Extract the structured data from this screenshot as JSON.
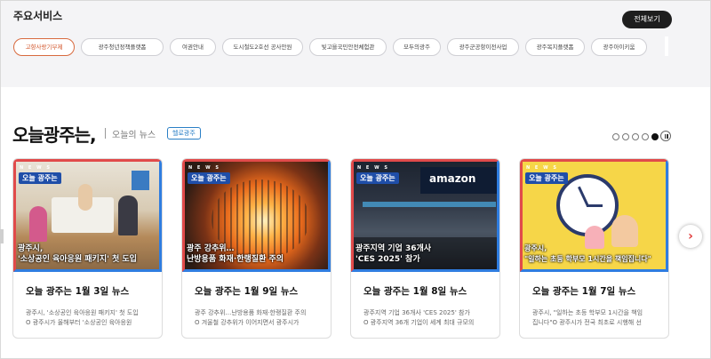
{
  "services": {
    "title": "주요서비스",
    "view_all": "전체보기",
    "chips": [
      {
        "label": "고향사랑기부제",
        "active": true
      },
      {
        "label": "광주청년정책플랫폼",
        "active": false
      },
      {
        "label": "여권안내",
        "active": false
      },
      {
        "label": "도시철도2호선 공사안원",
        "active": false
      },
      {
        "label": "빛고을국민안전체험관",
        "active": false
      },
      {
        "label": "모두의광주",
        "active": false
      },
      {
        "label": "광주군공항이전사업",
        "active": false
      },
      {
        "label": "광주복지플랫폼",
        "active": false
      },
      {
        "label": "광주아이키움",
        "active": false
      }
    ]
  },
  "news": {
    "title": "오늘광주는,",
    "subtitle": "오늘의 뉴스",
    "badge": "헬로광주",
    "pager_count": 5,
    "pager_active": 4,
    "cards": [
      {
        "title": "오늘 광주는 1월 3일 뉴스",
        "tag": "N E W S",
        "label": "오늘 광주는",
        "caption": "광주시,\n'소상공인 육아응원 패키지' 첫 도입",
        "body": "광주시, '소상공인 육아응원 패키지' 첫 도입\nO 광주시가 올해부터 '소상공인 육아응원"
      },
      {
        "title": "오늘 광주는 1월 9일 뉴스",
        "tag": "N E W S",
        "label": "오늘 광주는",
        "caption": "광주 강추위…\n난방용품 화재·한랭질환 주의",
        "body": "광주 강추위…난방용품 화재·한랭질환 주의\nO 겨울철 강추위가 이어지면서 광주시가"
      },
      {
        "title": "오늘 광주는 1월 8일 뉴스",
        "tag": "N E W S",
        "label": "오늘 광주는",
        "caption": "광주지역 기업 36개사\n'CES 2025' 참가",
        "body": "광주지역 기업 36개사 'CES 2025' 참가\nO 광주지역 36개 기업이 세계 최대 규모의"
      },
      {
        "title": "오늘 광주는 1월 7일 뉴스",
        "tag": "N E W S",
        "label": "오늘 광주는",
        "caption": "광주시,\n\"일하는 초등 학부모 1시간을 책임집니다\"",
        "body": "광주시, \"일하는 초등 학부모 1시간을 책임\n집니다\"O 광주시가 전국 최초로 시행해 선"
      }
    ]
  },
  "icons": {
    "next": "chevron-right-icon",
    "pause": "pause-icon"
  },
  "colors": {
    "active_chip": "#d2552a",
    "badge": "#2a7fc6",
    "card_frame_red": "#e14a4a",
    "card_frame_blue": "#2f7de0",
    "label_bg": "#1f4ea8"
  }
}
